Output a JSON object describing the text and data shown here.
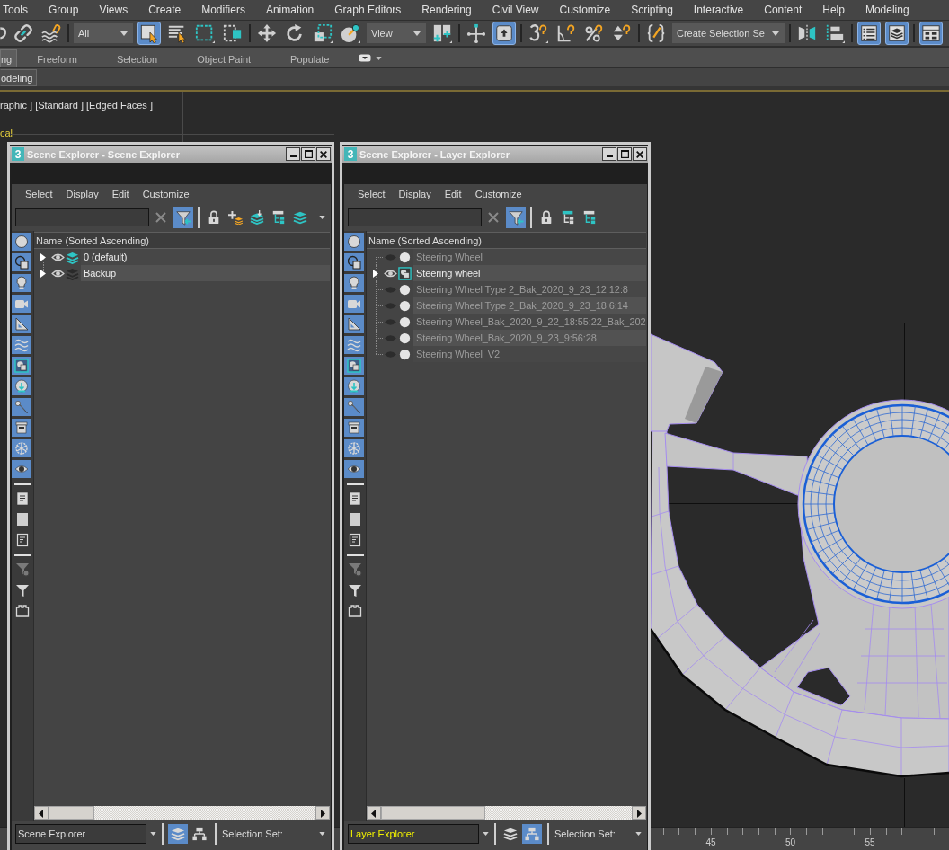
{
  "menu_bar": [
    "Tools",
    "Group",
    "Views",
    "Create",
    "Modifiers",
    "Animation",
    "Graph Editors",
    "Rendering",
    "Civil View",
    "Customize",
    "Scripting",
    "Interactive",
    "Content",
    "Help",
    "Modeling"
  ],
  "toolbar": [
    [
      {
        "kind": "button",
        "selected": false
      },
      {
        "kind": "button",
        "selected": false
      },
      {
        "kind": "button",
        "selected": false
      }
    ],
    [
      {
        "kind": "dropdown",
        "value": "All"
      },
      {
        "kind": "button",
        "selected": true
      },
      {
        "kind": "button",
        "selected": false
      },
      {
        "kind": "button",
        "selected": false
      },
      {
        "kind": "button",
        "selected": false
      }
    ],
    [
      {
        "kind": "button",
        "selected": false
      },
      {
        "kind": "button",
        "selected": false
      },
      {
        "kind": "button",
        "selected": false
      },
      {
        "kind": "button",
        "selected": false
      },
      {
        "kind": "dropdown",
        "value": "View"
      },
      {
        "kind": "button",
        "selected": false
      }
    ],
    [
      {
        "kind": "button",
        "selected": false
      },
      {
        "kind": "button",
        "selected": true
      }
    ],
    [
      {
        "kind": "button",
        "selected": false
      },
      {
        "kind": "button",
        "selected": false
      },
      {
        "kind": "button",
        "selected": false
      },
      {
        "kind": "button",
        "selected": false
      }
    ],
    [
      {
        "kind": "button",
        "selected": false
      },
      {
        "kind": "dropdown",
        "value": "Create Selection Se"
      }
    ],
    [
      {
        "kind": "button",
        "selected": false
      },
      {
        "kind": "button",
        "selected": false
      }
    ],
    [
      {
        "kind": "button",
        "selected": true
      },
      {
        "kind": "button",
        "selected": true
      }
    ],
    [
      {
        "kind": "button",
        "selected": true
      }
    ]
  ],
  "ribbon": {
    "tabs": [
      {
        "label": "ng",
        "selected": true
      },
      {
        "label": "Freeform",
        "selected": false
      },
      {
        "label": "Selection",
        "selected": false
      },
      {
        "label": "Object Paint",
        "selected": false
      },
      {
        "label": "Populate",
        "selected": false
      }
    ],
    "panels": [
      {
        "label": "odeling",
        "selected": true
      }
    ]
  },
  "viewport": {
    "label": "raphic ] [Standard ] [Edged Faces ]",
    "overlay_text": "cal"
  },
  "explorers": [
    {
      "logo": "3",
      "title": "Scene Explorer - Scene Explorer",
      "menu": [
        "Select",
        "Display",
        "Edit",
        "Customize"
      ],
      "filter_selected": true,
      "type_filters": [
        {
          "selected": true
        },
        {
          "selected": true
        },
        {
          "selected": true
        },
        {
          "selected": true
        },
        {
          "selected": true
        },
        {
          "selected": true
        },
        {
          "selected": true
        },
        {
          "selected": true
        },
        {
          "selected": true
        },
        {
          "selected": true
        },
        {
          "selected": true
        },
        {
          "selected": true
        }
      ],
      "column": "Name (Sorted Ascending)",
      "rows": [
        {
          "kind": "layer",
          "name": "0 (default)",
          "expandable": true,
          "visible": true,
          "active": true
        },
        {
          "kind": "layer",
          "name": "Backup",
          "expandable": true,
          "visible": true,
          "active": false
        }
      ],
      "explorer_type": {
        "value": "Scene Explorer",
        "highlighted": false
      },
      "view_modes": [
        {
          "selected": true
        },
        {
          "selected": false
        }
      ],
      "selection_set": "Selection Set:"
    },
    {
      "logo": "3",
      "title": "Scene Explorer - Layer Explorer",
      "menu": [
        "Select",
        "Display",
        "Edit",
        "Customize"
      ],
      "filter_selected": true,
      "type_filters": [
        {
          "selected": true
        },
        {
          "selected": true
        },
        {
          "selected": true
        },
        {
          "selected": true
        },
        {
          "selected": true
        },
        {
          "selected": true
        },
        {
          "selected": true
        },
        {
          "selected": true
        },
        {
          "selected": true
        },
        {
          "selected": true
        },
        {
          "selected": true
        },
        {
          "selected": true
        }
      ],
      "column": "Name (Sorted Ascending)",
      "rows": [
        {
          "kind": "node",
          "name": "Steering Wheel",
          "expandable": false,
          "visible": false,
          "active": false
        },
        {
          "kind": "node",
          "name": "Steering wheel",
          "expandable": true,
          "visible": true,
          "active": true
        },
        {
          "kind": "node",
          "name": "Steering Wheel Type 2_Bak_2020_9_23_12:12:8",
          "expandable": false,
          "visible": false,
          "active": false
        },
        {
          "kind": "node",
          "name": "Steering Wheel Type 2_Bak_2020_9_23_18:6:14",
          "expandable": false,
          "visible": false,
          "active": false
        },
        {
          "kind": "node",
          "name": "Steering Wheel_Bak_2020_9_22_18:55:22_Bak_202",
          "expandable": false,
          "visible": false,
          "active": false
        },
        {
          "kind": "node",
          "name": "Steering Wheel_Bak_2020_9_23_9:56:28",
          "expandable": false,
          "visible": false,
          "active": false
        },
        {
          "kind": "node",
          "name": "Steering Wheel_V2",
          "expandable": false,
          "visible": false,
          "active": false
        }
      ],
      "explorer_type": {
        "value": "Layer Explorer",
        "highlighted": true
      },
      "view_modes": [
        {
          "selected": false
        },
        {
          "selected": true
        }
      ],
      "selection_set": "Selection Set:"
    }
  ],
  "timeline": {
    "labels": [
      "45",
      "50",
      "55"
    ]
  }
}
